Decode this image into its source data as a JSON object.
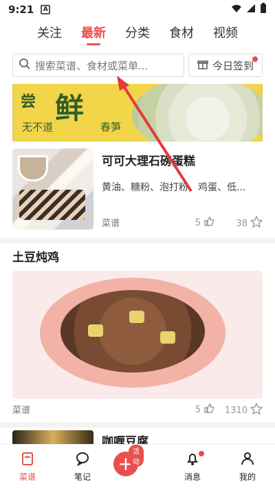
{
  "status": {
    "time": "9:21",
    "sim_label": "A"
  },
  "tabs": [
    {
      "label": "关注",
      "active": false
    },
    {
      "label": "最新",
      "active": true
    },
    {
      "label": "分类",
      "active": false
    },
    {
      "label": "食材",
      "active": false
    },
    {
      "label": "视频",
      "active": false
    }
  ],
  "search": {
    "placeholder": "搜索菜谱、食材或菜单..."
  },
  "checkin": {
    "label": "今日签到"
  },
  "banner": {
    "text_big": "鲜",
    "text_top": "尝",
    "text_left": "无不道",
    "text_right": "春笋"
  },
  "recipes": [
    {
      "title": "可可大理石磅蛋糕",
      "ingredients": "黄油、糖粉、泡打粉、鸡蛋、低...",
      "category": "菜谱",
      "likes": "5",
      "favorites": "38"
    },
    {
      "title": "土豆炖鸡",
      "category": "菜谱",
      "likes": "5",
      "favorites": "1310"
    },
    {
      "title": "咖喱豆腐"
    }
  ],
  "nav": {
    "recipes": "菜谱",
    "notes": "笔记",
    "add_tag": "活动",
    "messages": "消息",
    "me": "我的"
  },
  "colors": {
    "accent": "#e8504f",
    "banner_bg": "#f3d54a"
  }
}
